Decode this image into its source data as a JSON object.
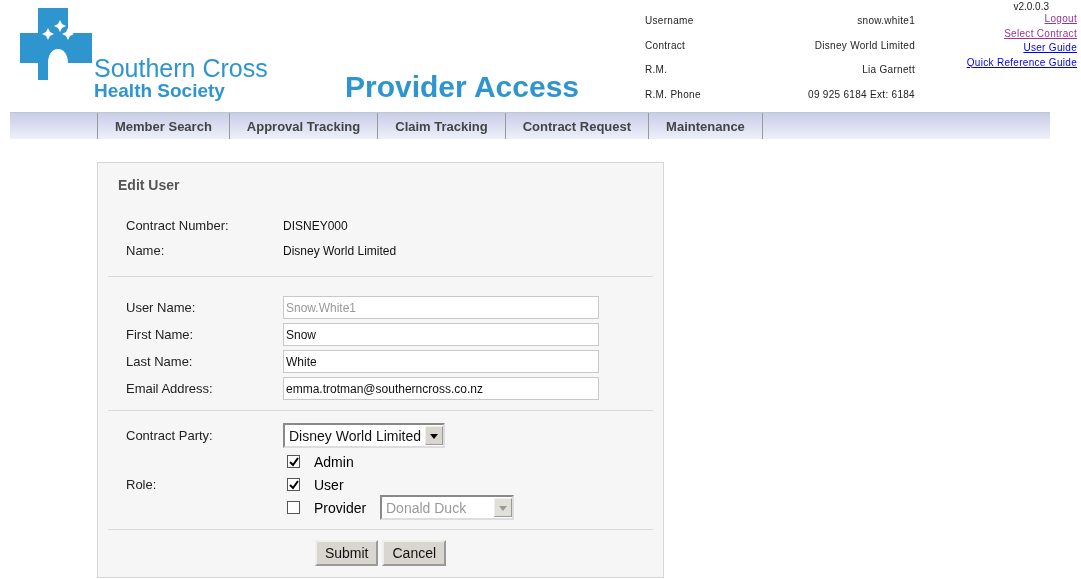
{
  "logo": {
    "line_1": "Southern Cross",
    "line_2": "Health Society"
  },
  "title": "Provider Access",
  "version": "v2.0.0.3",
  "account_info": [
    {
      "label": "Username",
      "value": "snow.white1"
    },
    {
      "label": "Contract",
      "value": "Disney World Limited"
    },
    {
      "label": "R.M.",
      "value": "Lia Garnett"
    },
    {
      "label": "R.M. Phone",
      "value": "09 925 6184 Ext: 6184"
    }
  ],
  "links": [
    {
      "label": "Logout",
      "visited": true
    },
    {
      "label": "Select Contract",
      "visited": true
    },
    {
      "label": "User Guide",
      "visited": false
    },
    {
      "label": "Quick Reference Guide",
      "visited": false
    }
  ],
  "nav": [
    "Member Search",
    "Approval Tracking",
    "Claim Tracking",
    "Contract Request",
    "Maintenance"
  ],
  "form": {
    "title": "Edit User",
    "info": [
      {
        "label": "Contract Number:",
        "value": "DISNEY000"
      },
      {
        "label": "Name:",
        "value": "Disney World Limited"
      }
    ],
    "fields": [
      {
        "label": "User Name:",
        "value": "Snow.White1",
        "disabled": true
      },
      {
        "label": "First Name:",
        "value": "Snow",
        "disabled": false
      },
      {
        "label": "Last Name:",
        "value": "White",
        "disabled": false
      },
      {
        "label": "Email Address:",
        "value": "emma.trotman@southerncross.co.nz",
        "disabled": false
      }
    ],
    "contract_party": {
      "label": "Contract Party:",
      "value": "Disney World Limited"
    },
    "role": {
      "label": "Role:",
      "options": [
        {
          "label": "Admin",
          "checked": true
        },
        {
          "label": "User",
          "checked": true
        },
        {
          "label": "Provider",
          "checked": false,
          "select": {
            "value": "Donald Duck",
            "disabled": true
          }
        }
      ]
    },
    "buttons": [
      "Submit",
      "Cancel"
    ]
  }
}
